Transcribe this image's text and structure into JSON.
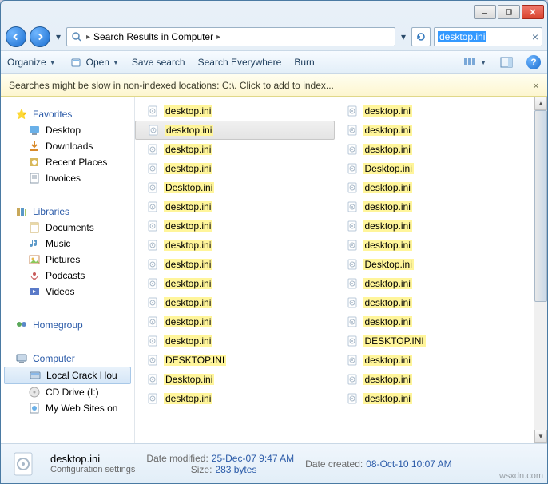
{
  "breadcrumb": {
    "text": "Search Results in Computer"
  },
  "search": {
    "value": "desktop.ini"
  },
  "toolbar": {
    "organize": "Organize",
    "open": "Open",
    "save": "Save search",
    "everywhere": "Search Everywhere",
    "burn": "Burn"
  },
  "infobar": {
    "text": "Searches might be slow in non-indexed locations: C:\\. Click to add to index..."
  },
  "sidebar": {
    "favorites": {
      "label": "Favorites",
      "items": [
        "Desktop",
        "Downloads",
        "Recent Places",
        "Invoices"
      ]
    },
    "libraries": {
      "label": "Libraries",
      "items": [
        "Documents",
        "Music",
        "Pictures",
        "Podcasts",
        "Videos"
      ]
    },
    "homegroup": {
      "label": "Homegroup"
    },
    "computer": {
      "label": "Computer",
      "items": [
        "Local Crack Hou",
        "CD Drive (I:)",
        "My Web Sites on"
      ]
    }
  },
  "files_left": [
    "desktop.ini",
    "desktop.ini",
    "desktop.ini",
    "desktop.ini",
    "Desktop.ini",
    "desktop.ini",
    "desktop.ini",
    "desktop.ini",
    "desktop.ini",
    "desktop.ini",
    "desktop.ini",
    "desktop.ini",
    "desktop.ini",
    "DESKTOP.INI",
    "Desktop.ini",
    "desktop.ini"
  ],
  "files_right": [
    "desktop.ini",
    "desktop.ini",
    "desktop.ini",
    "Desktop.ini",
    "desktop.ini",
    "desktop.ini",
    "desktop.ini",
    "desktop.ini",
    "Desktop.ini",
    "desktop.ini",
    "desktop.ini",
    "desktop.ini",
    "DESKTOP.INI",
    "desktop.ini",
    "desktop.ini",
    "desktop.ini"
  ],
  "selected_index_left": 1,
  "details": {
    "name": "desktop.ini",
    "type": "Configuration settings",
    "modified_label": "Date modified:",
    "modified": "25-Dec-07 9:47 AM",
    "size_label": "Size:",
    "size": "283 bytes",
    "created_label": "Date created:",
    "created": "08-Oct-10 10:07 AM"
  },
  "watermark": "wsxdn.com"
}
